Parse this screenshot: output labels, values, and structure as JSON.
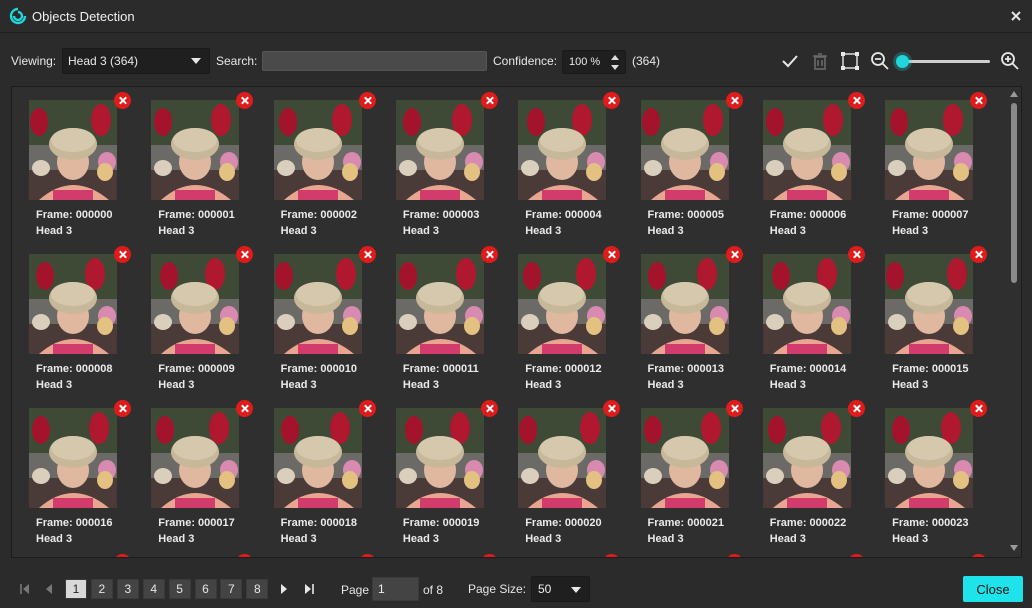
{
  "window": {
    "title": "Objects Detection",
    "logo_icon": "app-logo-icon",
    "close_icon": "close-icon"
  },
  "toolbar": {
    "viewing_label": "Viewing:",
    "viewing_value": "Head 3 (364)",
    "search_label": "Search:",
    "search_value": "",
    "confidence_label": "Confidence:",
    "confidence_value": "100 %",
    "count": "(364)",
    "icons": [
      "checkmark-icon",
      "trash-icon",
      "bounding-box-icon",
      "zoom-out-icon",
      "zoom-in-icon"
    ],
    "zoom_level": 0,
    "accent_color": "#1ed6dc"
  },
  "grid": {
    "items": [
      {
        "frame": "Frame: 000000",
        "label": "Head 3"
      },
      {
        "frame": "Frame: 000001",
        "label": "Head 3"
      },
      {
        "frame": "Frame: 000002",
        "label": "Head 3"
      },
      {
        "frame": "Frame: 000003",
        "label": "Head 3"
      },
      {
        "frame": "Frame: 000004",
        "label": "Head 3"
      },
      {
        "frame": "Frame: 000005",
        "label": "Head 3"
      },
      {
        "frame": "Frame: 000006",
        "label": "Head 3"
      },
      {
        "frame": "Frame: 000007",
        "label": "Head 3"
      },
      {
        "frame": "Frame: 000008",
        "label": "Head 3"
      },
      {
        "frame": "Frame: 000009",
        "label": "Head 3"
      },
      {
        "frame": "Frame: 000010",
        "label": "Head 3"
      },
      {
        "frame": "Frame: 000011",
        "label": "Head 3"
      },
      {
        "frame": "Frame: 000012",
        "label": "Head 3"
      },
      {
        "frame": "Frame: 000013",
        "label": "Head 3"
      },
      {
        "frame": "Frame: 000014",
        "label": "Head 3"
      },
      {
        "frame": "Frame: 000015",
        "label": "Head 3"
      },
      {
        "frame": "Frame: 000016",
        "label": "Head 3"
      },
      {
        "frame": "Frame: 000017",
        "label": "Head 3"
      },
      {
        "frame": "Frame: 000018",
        "label": "Head 3"
      },
      {
        "frame": "Frame: 000019",
        "label": "Head 3"
      },
      {
        "frame": "Frame: 000020",
        "label": "Head 3"
      },
      {
        "frame": "Frame: 000021",
        "label": "Head 3"
      },
      {
        "frame": "Frame: 000022",
        "label": "Head 3"
      },
      {
        "frame": "Frame: 000023",
        "label": "Head 3"
      }
    ],
    "remove_icon": "remove-x-icon",
    "remove_color": "#e01b1b"
  },
  "pagination": {
    "pages": [
      "1",
      "2",
      "3",
      "4",
      "5",
      "6",
      "7",
      "8"
    ],
    "current_page": "1",
    "page_label": "Page",
    "page_input": "1",
    "of_label": "of 8",
    "page_size_label": "Page Size:",
    "page_size_value": "50",
    "nav_icons": [
      "first-page-icon",
      "prev-page-icon",
      "next-page-icon",
      "last-page-icon"
    ]
  },
  "footer": {
    "close_label": "Close",
    "close_color": "#1fe3ea"
  }
}
